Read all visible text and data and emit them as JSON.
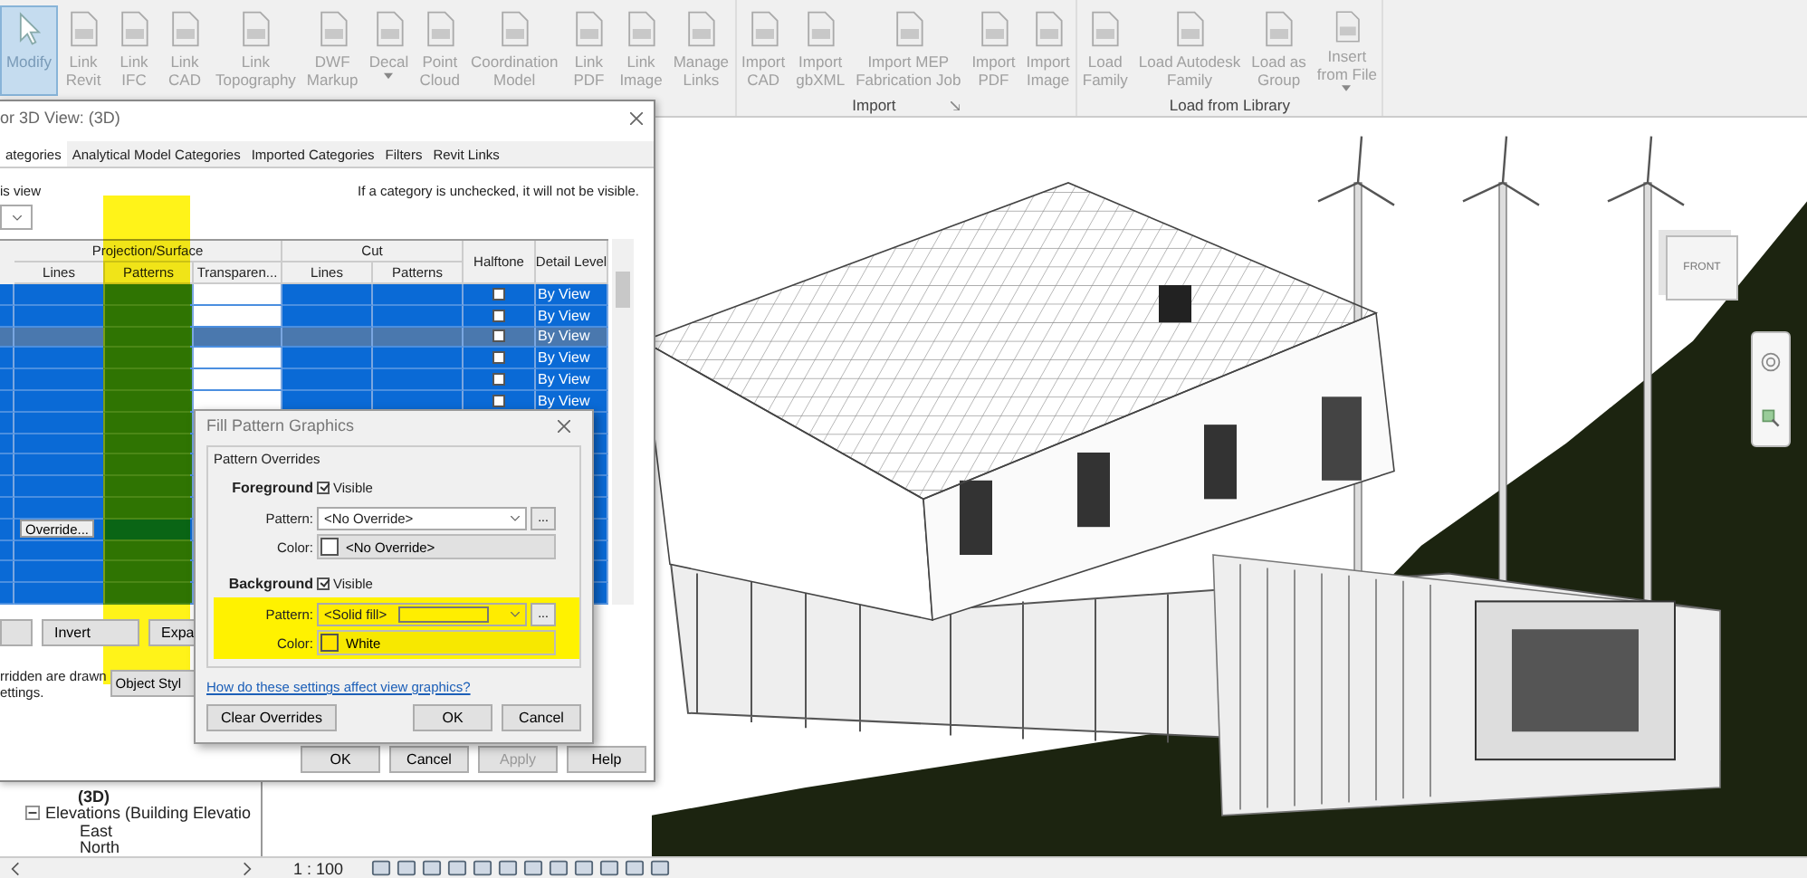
{
  "ribbon": {
    "groups": [
      {
        "items": [
          {
            "lines": [
              "Modify"
            ],
            "selected": true
          },
          {
            "lines": [
              "Link",
              "Revit"
            ],
            "selected": false
          },
          {
            "lines": [
              "Link",
              "IFC"
            ],
            "selected": false
          },
          {
            "lines": [
              "Link",
              "CAD"
            ],
            "selected": false
          },
          {
            "lines": [
              "Link",
              "Topography"
            ],
            "selected": false
          },
          {
            "lines": [
              "DWF",
              "Markup"
            ],
            "selected": false
          },
          {
            "lines": [
              "Decal"
            ],
            "selected": false,
            "caret": true
          },
          {
            "lines": [
              "Point",
              "Cloud"
            ],
            "selected": false
          },
          {
            "lines": [
              "Coordination",
              "Model"
            ],
            "selected": false
          },
          {
            "lines": [
              "Link",
              "PDF"
            ],
            "selected": false
          },
          {
            "lines": [
              "Link",
              "Image"
            ],
            "selected": false
          },
          {
            "lines": [
              "Manage",
              "Links"
            ],
            "selected": false
          }
        ]
      },
      {
        "label": "Import",
        "launcher": true,
        "items": [
          {
            "lines": [
              "Import",
              "CAD"
            ],
            "selected": false
          },
          {
            "lines": [
              "Import",
              "gbXML"
            ],
            "selected": false
          },
          {
            "lines": [
              "Import MEP",
              "Fabrication Job"
            ],
            "selected": false
          },
          {
            "lines": [
              "Import",
              "PDF"
            ],
            "selected": false
          },
          {
            "lines": [
              "Import",
              "Image"
            ],
            "selected": false
          }
        ]
      },
      {
        "label": "Load from Library",
        "items": [
          {
            "lines": [
              "Load",
              "Family"
            ],
            "selected": false
          },
          {
            "lines": [
              "Load Autodesk",
              "Family"
            ],
            "selected": false
          },
          {
            "lines": [
              "Load as",
              "Group"
            ],
            "selected": false
          },
          {
            "lines": [
              "Insert",
              "from File"
            ],
            "selected": false,
            "caret": true
          }
        ]
      }
    ]
  },
  "project_browser": {
    "items": [
      {
        "label": "(3D)",
        "active": true
      },
      {
        "label": "Elevations (Building Elevatio",
        "active": false,
        "expanded": true,
        "children": [
          {
            "label": "East",
            "active": false
          },
          {
            "label": "North",
            "active": false
          }
        ]
      }
    ]
  },
  "viewport": {
    "viewcube_face": "FRONT"
  },
  "status_bar": {
    "scale": "1 : 100"
  },
  "vg_dialog": {
    "title": "or 3D View: (3D)",
    "tabs": [
      {
        "label": "ategories",
        "selected": true
      },
      {
        "label": "Analytical Model Categories",
        "selected": false
      },
      {
        "label": "Imported Categories",
        "selected": false
      },
      {
        "label": "Filters",
        "selected": false
      },
      {
        "label": "Revit Links",
        "selected": false
      }
    ],
    "filter_label": "is view",
    "hint": "If a category is unchecked, it will not be visible.",
    "columns": {
      "projection": "Projection/Surface",
      "projection_sub": [
        "Lines",
        "Patterns",
        "Transparen..."
      ],
      "cut": "Cut",
      "cut_sub": [
        "Lines",
        "Patterns"
      ],
      "halftone": "Halftone",
      "detail": "Detail Level"
    },
    "rows": [
      {
        "selected": false,
        "pattern_override": true,
        "halftone": false,
        "detail_level": "By View"
      },
      {
        "selected": false,
        "pattern_override": true,
        "halftone": false,
        "detail_level": "By View"
      },
      {
        "selected": true,
        "pattern_override": true,
        "halftone": false,
        "detail_level": "By View"
      },
      {
        "selected": false,
        "pattern_override": true,
        "halftone": false,
        "detail_level": "By View"
      },
      {
        "selected": false,
        "pattern_override": true,
        "halftone": false,
        "detail_level": "By View"
      },
      {
        "selected": false,
        "pattern_override": true,
        "halftone": false,
        "detail_level": "By View"
      },
      {
        "selected": false,
        "pattern_override": true
      },
      {
        "selected": false,
        "pattern_override": true
      },
      {
        "selected": false,
        "pattern_override": true
      },
      {
        "selected": false,
        "pattern_override": true
      },
      {
        "selected": false,
        "pattern_override": true
      },
      {
        "selected": false,
        "pattern_override": false,
        "override_button": "Override..."
      },
      {
        "selected": false,
        "pattern_override": true
      },
      {
        "selected": false,
        "pattern_override": true
      },
      {
        "selected": false,
        "pattern_override": true
      }
    ],
    "buttons": [
      "Invert",
      "Expa"
    ],
    "note": [
      "rridden are drawn",
      "ettings."
    ],
    "object_styles": "Object Styl",
    "footer": [
      {
        "label": "OK",
        "disabled": false
      },
      {
        "label": "Cancel",
        "disabled": false
      },
      {
        "label": "Apply",
        "disabled": true
      },
      {
        "label": "Help",
        "disabled": false
      }
    ]
  },
  "fill_dialog": {
    "title": "Fill Pattern Graphics",
    "group": "Pattern Overrides",
    "sections": [
      {
        "heading": "Foreground",
        "visible_label": "Visible",
        "visible": true,
        "pattern_label": "Pattern:",
        "pattern": "<No Override>",
        "preview": false,
        "browse": "...",
        "color_label": "Color:",
        "color_text": "<No Override>",
        "highlighted": false
      },
      {
        "heading": "Background",
        "visible_label": "Visible",
        "visible": true,
        "pattern_label": "Pattern:",
        "pattern": "<Solid fill>",
        "preview": true,
        "browse": "...",
        "color_label": "Color:",
        "color_text": "White",
        "highlighted": true
      }
    ],
    "link": "How do these settings affect view graphics?",
    "clear": "Clear Overrides",
    "ok": "OK",
    "cancel": "Cancel"
  }
}
